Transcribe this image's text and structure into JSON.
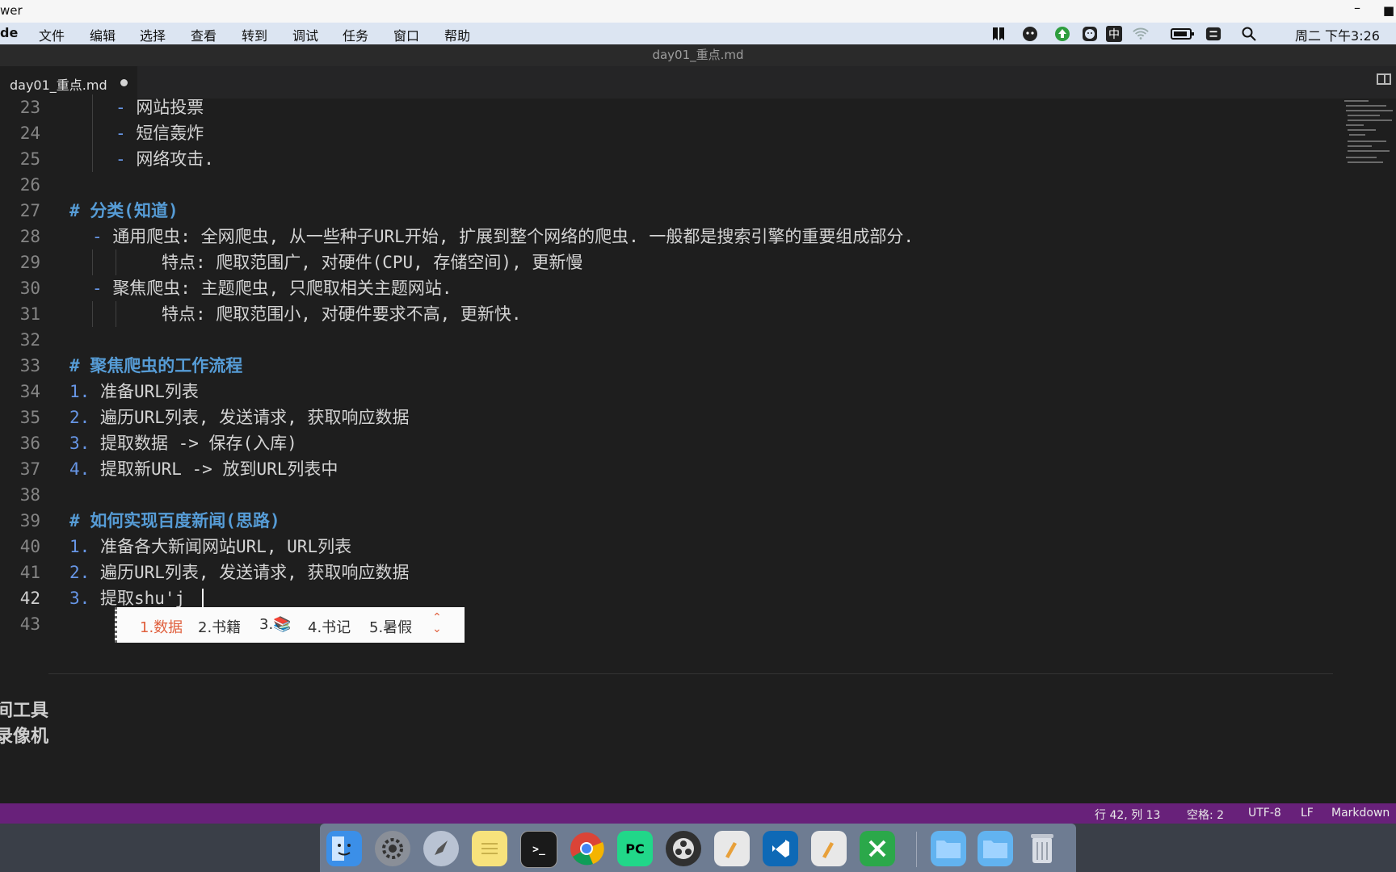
{
  "outer_window": {
    "title_fragment": "wer",
    "minimize": "–",
    "right_glyph": "■"
  },
  "menubar": {
    "app": "de",
    "items": [
      "文件",
      "编辑",
      "选择",
      "查看",
      "转到",
      "调试",
      "任务",
      "窗口",
      "帮助"
    ],
    "clock": "周二 下午3:26",
    "status_icons": [
      "bookmark-icon",
      "chat-icon",
      "upload-icon",
      "face-icon",
      "input-method-icon",
      "wifi-icon",
      "battery-icon",
      "screen-share-icon",
      "search-icon"
    ],
    "input_method_label": "中"
  },
  "editor": {
    "window_title": "day01_重点.md",
    "tab": {
      "label": "day01_重点.md",
      "dirty": true
    },
    "lines": [
      {
        "num": "23",
        "text": "网站投票"
      },
      {
        "num": "24",
        "text": "短信轰炸"
      },
      {
        "num": "25",
        "text": "网络攻击."
      },
      {
        "num": "26",
        "text": ""
      },
      {
        "num": "27",
        "text": "分类(知道)"
      },
      {
        "num": "28",
        "text": "通用爬虫: 全网爬虫, 从一些种子URL开始, 扩展到整个网络的爬虫. 一般都是搜索引擎的重要组成部分."
      },
      {
        "num": "29",
        "text": "特点: 爬取范围广, 对硬件(CPU, 存储空间), 更新慢"
      },
      {
        "num": "30",
        "text": "聚焦爬虫: 主题爬虫, 只爬取相关主题网站."
      },
      {
        "num": "31",
        "text": "特点: 爬取范围小, 对硬件要求不高, 更新快."
      },
      {
        "num": "32",
        "text": ""
      },
      {
        "num": "33",
        "text": "聚焦爬虫的工作流程"
      },
      {
        "num": "34",
        "text": "准备URL列表"
      },
      {
        "num": "35",
        "text": "遍历URL列表, 发送请求, 获取响应数据"
      },
      {
        "num": "36",
        "text": "提取数据 -> 保存(入库)"
      },
      {
        "num": "37",
        "text": "提取新URL -> 放到URL列表中"
      },
      {
        "num": "38",
        "text": ""
      },
      {
        "num": "39",
        "text": "如何实现百度新闻(思路)"
      },
      {
        "num": "40",
        "text": "准备各大新闻网站URL, URL列表"
      },
      {
        "num": "41",
        "text": "遍历URL列表, 发送请求, 获取响应数据"
      },
      {
        "num": "42",
        "text": "提取shu'j"
      },
      {
        "num": "43",
        "text": ""
      }
    ],
    "markers": {
      "dash": "-",
      "hash": "#",
      "ol": [
        "1.",
        "2.",
        "3.",
        "4.",
        "1.",
        "2.",
        "3."
      ]
    },
    "current_line": "42"
  },
  "ime": {
    "candidates": [
      "1.数据",
      "2.书籍",
      "3.📚",
      "4.书记",
      "5.暑假"
    ],
    "selected_index": 0
  },
  "overlay": {
    "line1": "间工具",
    "line2": "录像机"
  },
  "statusbar": {
    "position": "行 42, 列 13",
    "indent": "空格: 2",
    "encoding": "UTF-8",
    "eol": "LF",
    "language": "Markdown"
  },
  "dock": {
    "apps": [
      "finder-icon",
      "system-preferences-icon",
      "launchpad-icon",
      "notes-icon",
      "terminal-icon",
      "chrome-icon",
      "pycharm-icon",
      "obs-icon",
      "textedit-icon",
      "vscode-icon",
      "textedit-icon",
      "xmind-icon",
      "folder-icon",
      "folder-icon",
      "trash-icon"
    ],
    "pycharm_label": "PC",
    "terminal_label": ">_"
  },
  "colors": {
    "accent_statusbar": "#68217a",
    "heading": "#569cd6",
    "ime_selected": "#e0603e"
  }
}
